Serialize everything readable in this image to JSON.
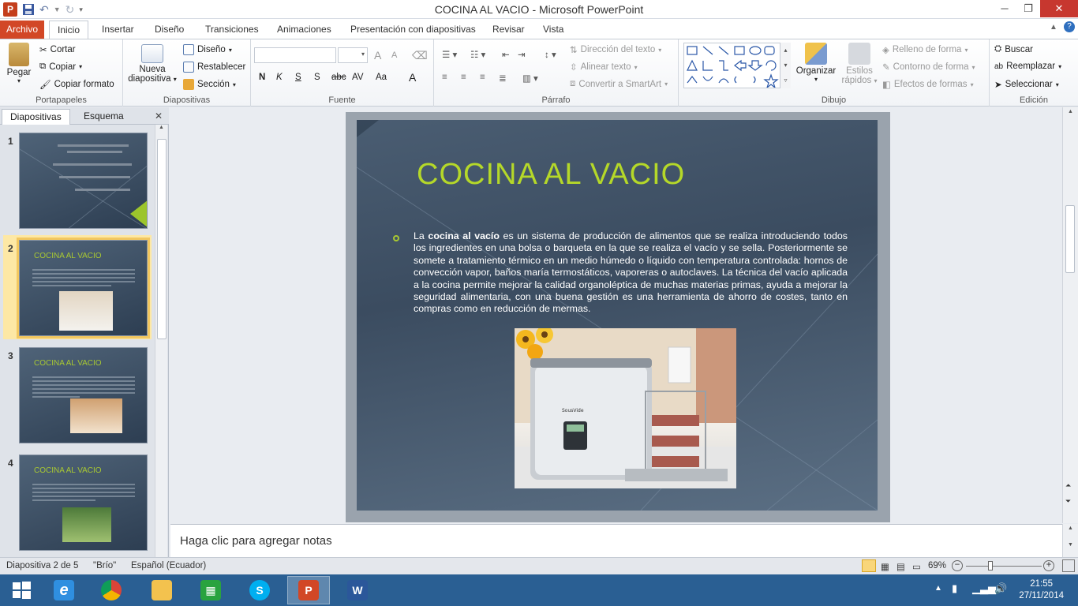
{
  "window": {
    "title": "COCINA AL VACIO  -  Microsoft PowerPoint",
    "minimize": "─",
    "maximize": "❐",
    "close": "✕"
  },
  "ribbon_tabs": [
    "Archivo",
    "Inicio",
    "Insertar",
    "Diseño",
    "Transiciones",
    "Animaciones",
    "Presentación con diapositivas",
    "Revisar",
    "Vista"
  ],
  "ribbon": {
    "portapapeles": {
      "label": "Portapapeles",
      "paste": "Pegar",
      "cut": "Cortar",
      "copy": "Copiar",
      "format_painter": "Copiar formato"
    },
    "diapositivas": {
      "label": "Diapositivas",
      "new_slide_1": "Nueva",
      "new_slide_2": "diapositiva",
      "layout": "Diseño",
      "reset": "Restablecer",
      "section": "Sección"
    },
    "fuente": {
      "label": "Fuente",
      "bold": "N",
      "italic": "K",
      "underline": "S",
      "shadow": "S",
      "strike": "abc",
      "spacing": "AV",
      "case": "Aa",
      "grow": "A",
      "shrink": "A",
      "color": "A"
    },
    "parrafo": {
      "label": "Párrafo",
      "text_direction": "Dirección del texto",
      "align_text": "Alinear texto",
      "smartart": "Convertir a SmartArt"
    },
    "dibujo": {
      "label": "Dibujo",
      "arrange": "Organizar",
      "quick_styles_1": "Estilos",
      "quick_styles_2": "rápidos",
      "fill": "Relleno de forma",
      "outline": "Contorno de forma",
      "effects": "Efectos de formas"
    },
    "edicion": {
      "label": "Edición",
      "find": "Buscar",
      "replace": "Reemplazar",
      "select": "Seleccionar"
    }
  },
  "left_panel": {
    "tabs": [
      "Diapositivas",
      "Esquema"
    ],
    "close": "✕",
    "thumbnails": [
      {
        "num": "1",
        "title": ""
      },
      {
        "num": "2",
        "title": "COCINA AL VACIO"
      },
      {
        "num": "3",
        "title": "COCINA AL VACIO"
      },
      {
        "num": "4",
        "title": "COCINA AL VACIO"
      }
    ]
  },
  "slide": {
    "title": "COCINA AL VACIO",
    "body_bold": "cocina al vacío",
    "body_prefix": "La",
    "body_rest": "es un sistema de producción de alimentos que se realiza introduciendo todos los ingredientes en una bolsa o barqueta en la que se realiza el vacío y se sella. Posteriormente se somete a tratamiento térmico en un medio húmedo o líquido con temperatura controlada: hornos de convección vapor, baños maría termostáticos, vaporeras o autoclaves. La técnica del vacío aplicada a la cocina permite mejorar la calidad organoléptica de muchas materias primas, ayuda a mejorar la seguridad alimentaria, con una buena gestión es una herramienta de ahorro de costes, tanto en compras como en reducción de mermas.",
    "photo_brand": "SousVide"
  },
  "notes": {
    "placeholder": "Haga clic para agregar notas"
  },
  "status": {
    "slide_of": "Diapositiva 2 de 5",
    "theme": "\"Brío\"",
    "language": "Español (Ecuador)",
    "zoom": "69%"
  },
  "taskbar": {
    "time": "21:55",
    "date": "27/11/2014"
  },
  "colors": {
    "accent_file_tab": "#d24726",
    "slide_title": "#b5d829",
    "taskbar": "#2a5f93"
  }
}
